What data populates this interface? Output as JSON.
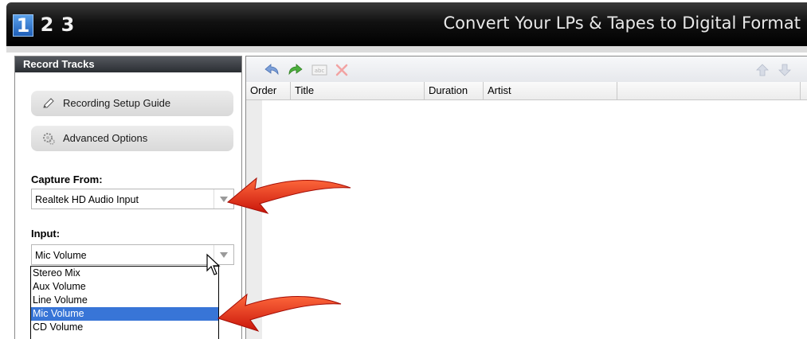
{
  "header": {
    "steps": [
      "1",
      "2",
      "3"
    ],
    "active_step": "1",
    "title": "Convert Your LPs & Tapes to Digital Format"
  },
  "left_panel": {
    "title": "Record Tracks",
    "buttons": [
      {
        "label": "Recording Setup Guide",
        "icon": "pencil-icon"
      },
      {
        "label": "Advanced Options",
        "icon": "gear-icon"
      }
    ],
    "capture_from": {
      "label": "Capture From:",
      "value": "Realtek HD Audio Input"
    },
    "input": {
      "label": "Input:",
      "value": "Mic Volume",
      "options": [
        "Stereo Mix",
        "Aux Volume",
        "Line Volume",
        "Mic Volume",
        "CD Volume"
      ],
      "selected": "Mic Volume"
    }
  },
  "track_grid": {
    "toolbar_icons": [
      "undo-icon",
      "redo-icon",
      "rename-icon",
      "delete-icon",
      "move-up-icon",
      "move-down-icon"
    ],
    "columns": [
      "Order",
      "Title",
      "Duration",
      "Artist"
    ]
  },
  "colors": {
    "header_bg": "#000000",
    "active_step": "#3a86d8",
    "selection": "#3875d7",
    "callout_arrow": "#e8341c"
  }
}
